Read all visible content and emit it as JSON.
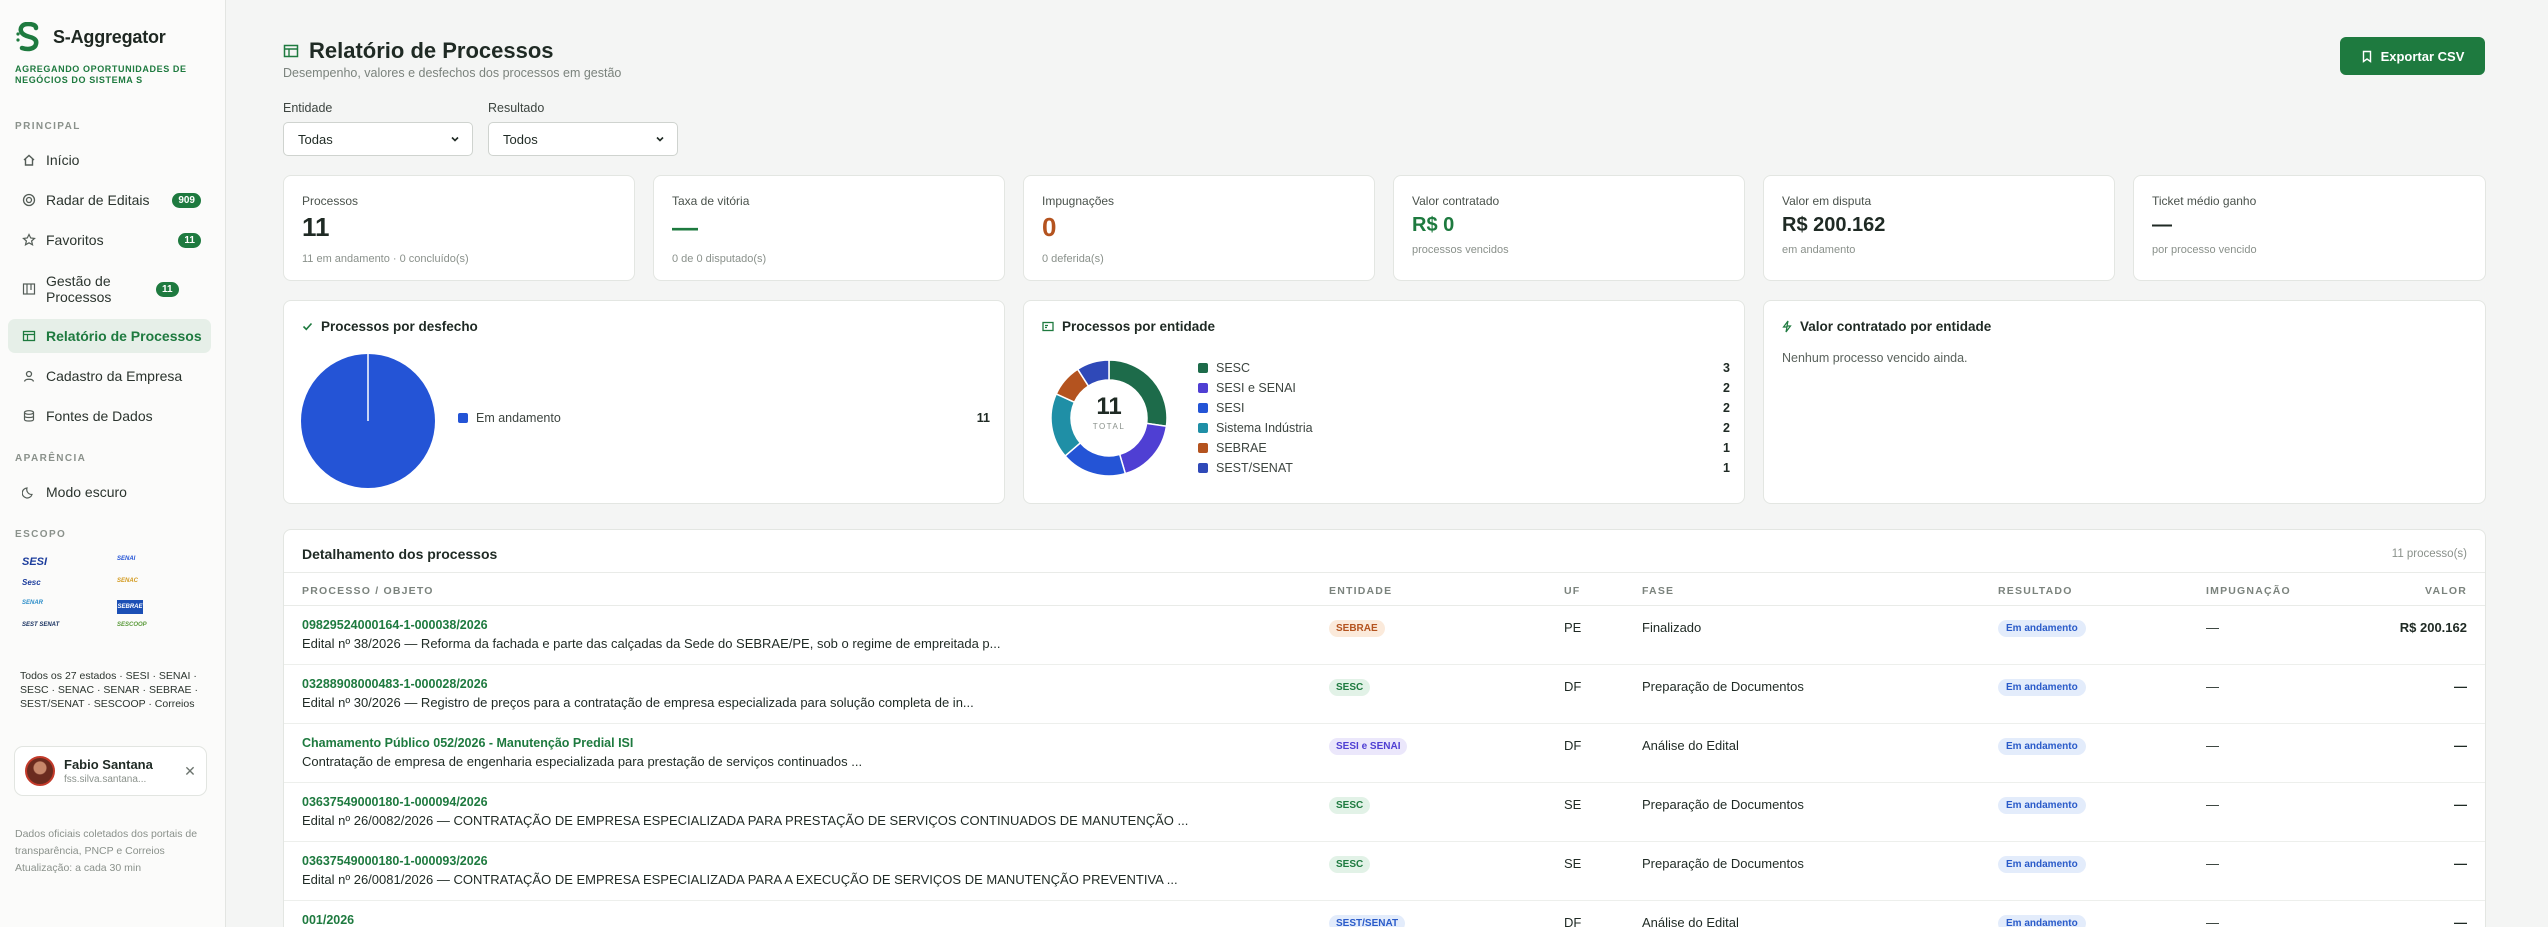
{
  "brand": {
    "name": "S-Aggregator",
    "tagline": "AGREGANDO OPORTUNIDADES DE NEGÓCIOS DO SISTEMA S"
  },
  "sidebar": {
    "principal_label": "PRINCIPAL",
    "items": [
      {
        "label": "Início",
        "icon": "home-icon"
      },
      {
        "label": "Radar de Editais",
        "icon": "radar-icon",
        "badge": "909"
      },
      {
        "label": "Favoritos",
        "icon": "star-icon",
        "badge": "11"
      },
      {
        "label": "Gestão de Processos",
        "icon": "board-icon",
        "badge": "11"
      },
      {
        "label": "Relatório de Processos",
        "icon": "table-icon",
        "active": true
      },
      {
        "label": "Cadastro da Empresa",
        "icon": "user-icon"
      },
      {
        "label": "Fontes de Dados",
        "icon": "database-icon"
      }
    ],
    "appearance_label": "APARÊNCIA",
    "dark_mode_label": "Modo escuro",
    "scope_label": "ESCOPO",
    "logos": [
      "SESI",
      "SENAI",
      "Sesc",
      "SENAC",
      "SENAR",
      "SEBRAE",
      "SEST SENAT",
      "SESCOOP"
    ],
    "scope_text": "Todos os 27 estados · SESI · SENAI · SESC · SENAC · SENAR · SEBRAE · SEST/SENAT · SESCOOP · Correios",
    "user": {
      "name": "Fabio Santana",
      "email": "fss.silva.santana..."
    },
    "footer": [
      "Dados oficiais coletados dos portais de transparência, PNCP e Correios",
      "Atualização: a cada 30 min"
    ]
  },
  "header": {
    "title": "Relatório de Processos",
    "subtitle": "Desempenho, valores e desfechos dos processos em gestão",
    "export_label": "Exportar CSV"
  },
  "filters": [
    {
      "label": "Entidade",
      "value": "Todas"
    },
    {
      "label": "Resultado",
      "value": "Todos"
    }
  ],
  "kpis": [
    {
      "label": "Processos",
      "value": "11",
      "sub": "11 em andamento · 0 concluído(s)",
      "tone": "default"
    },
    {
      "label": "Taxa de vitória",
      "value": "—",
      "sub": "0 de 0 disputado(s)",
      "tone": "green"
    },
    {
      "label": "Impugnações",
      "value": "0",
      "sub": "0 deferida(s)",
      "tone": "orange"
    },
    {
      "label": "Valor contratado",
      "value": "R$ 0",
      "sub": "processos vencidos",
      "tone": "green"
    },
    {
      "label": "Valor em disputa",
      "value": "R$ 200.162",
      "sub": "em andamento",
      "tone": "default"
    },
    {
      "label": "Ticket médio ganho",
      "value": "—",
      "sub": "por processo vencido",
      "tone": "default"
    }
  ],
  "panel_outcome": {
    "title": "Processos por desfecho",
    "chart_data": {
      "type": "pie",
      "slices": [
        {
          "name": "Em andamento",
          "value": 11,
          "color": "#2454d6"
        }
      ]
    }
  },
  "panel_entity": {
    "title": "Processos por entidade",
    "total_value": "11",
    "total_label": "TOTAL",
    "chart_data": {
      "type": "pie",
      "slices": [
        {
          "name": "SESC",
          "value": 3,
          "color": "#1d6b4a"
        },
        {
          "name": "SESI e SENAI",
          "value": 2,
          "color": "#4f3fd3"
        },
        {
          "name": "SESI",
          "value": 2,
          "color": "#2454d6"
        },
        {
          "name": "Sistema Indústria",
          "value": 2,
          "color": "#1f8fa6"
        },
        {
          "name": "SEBRAE",
          "value": 1,
          "color": "#b4531f"
        },
        {
          "name": "SEST/SENAT",
          "value": 1,
          "color": "#2f49b8"
        }
      ]
    }
  },
  "panel_value": {
    "title": "Valor contratado por entidade",
    "empty_text": "Nenhum processo vencido ainda."
  },
  "table": {
    "title": "Detalhamento dos processos",
    "count": "11 processo(s)",
    "columns": [
      "PROCESSO / OBJETO",
      "ENTIDADE",
      "UF",
      "FASE",
      "RESULTADO",
      "IMPUGNAÇÃO",
      "VALOR"
    ],
    "rows": [
      {
        "id": "09829524000164-1-000038/2026",
        "desc": "Edital nº 38/2026 — Reforma da fachada e parte das calçadas da Sede do SEBRAE/PE, sob o regime de empreitada p...",
        "entity": "SEBRAE",
        "entity_tone": "orange",
        "uf": "PE",
        "phase": "Finalizado",
        "result": "Em andamento",
        "impugnacao": "—",
        "value": "R$ 200.162"
      },
      {
        "id": "03288908000483-1-000028/2026",
        "desc": "Edital nº 30/2026 — Registro de preços para a contratação de empresa especializada para solução completa de in...",
        "entity": "SESC",
        "entity_tone": "green",
        "uf": "DF",
        "phase": "Preparação de Documentos",
        "result": "Em andamento",
        "impugnacao": "—",
        "value": "—"
      },
      {
        "id": "Chamamento Público 052/2026 - Manutenção Predial ISI",
        "desc": "Contratação de empresa de engenharia especializada para prestação de serviços continuados ...",
        "entity": "SESI e SENAI",
        "entity_tone": "purple",
        "uf": "DF",
        "phase": "Análise do Edital",
        "result": "Em andamento",
        "impugnacao": "—",
        "value": "—"
      },
      {
        "id": "03637549000180-1-000094/2026",
        "desc": "Edital nº 26/0082/2026 — CONTRATAÇÃO DE EMPRESA ESPECIALIZADA PARA PRESTAÇÃO DE SERVIÇOS CONTINUADOS DE MANUTENÇÃO ...",
        "entity": "SESC",
        "entity_tone": "green",
        "uf": "SE",
        "phase": "Preparação de Documentos",
        "result": "Em andamento",
        "impugnacao": "—",
        "value": "—"
      },
      {
        "id": "03637549000180-1-000093/2026",
        "desc": "Edital nº 26/0081/2026 — CONTRATAÇÃO DE EMPRESA ESPECIALIZADA PARA A EXECUÇÃO DE SERVIÇOS DE MANUTENÇÃO PREVENTIVA ...",
        "entity": "SESC",
        "entity_tone": "green",
        "uf": "SE",
        "phase": "Preparação de Documentos",
        "result": "Em andamento",
        "impugnacao": "—",
        "value": "—"
      },
      {
        "id": "001/2026",
        "desc": "",
        "entity": "SEST/SENAT",
        "entity_tone": "blue",
        "uf": "DF",
        "phase": "Análise do Edital",
        "result": "Em andamento",
        "impugnacao": "—",
        "value": "—"
      }
    ]
  }
}
